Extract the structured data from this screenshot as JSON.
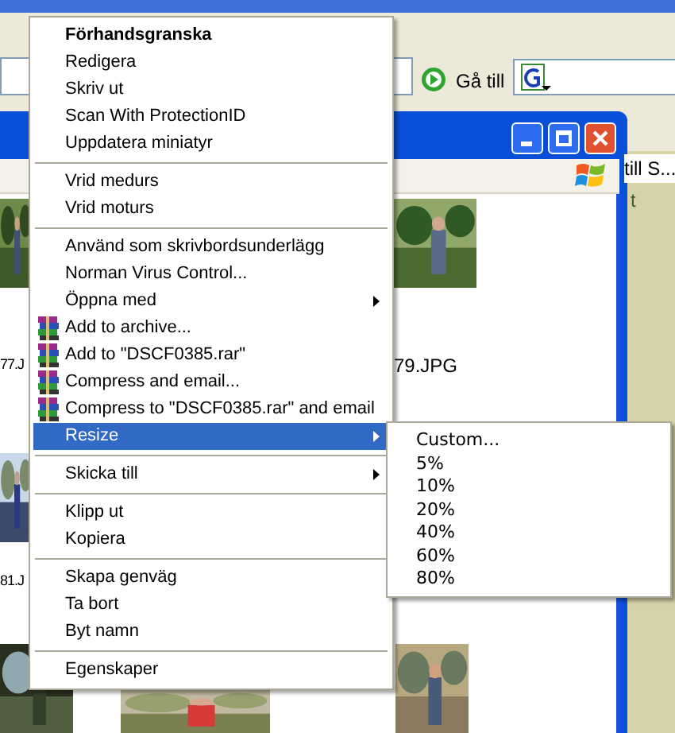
{
  "browser": {
    "go_label": "Gå till"
  },
  "window": {
    "toolbar_text": "till S...",
    "side_text": "t"
  },
  "thumbnails": [
    {
      "caption": "77.J"
    },
    {
      "caption": "79.JPG"
    },
    {
      "caption": "81.J"
    }
  ],
  "context_menu": {
    "items": [
      {
        "kind": "item",
        "label": "Förhandsgranska",
        "bold": true,
        "submenu": false,
        "selected": false
      },
      {
        "kind": "item",
        "label": "Redigera",
        "bold": false,
        "submenu": false,
        "selected": false
      },
      {
        "kind": "item",
        "label": "Skriv ut",
        "bold": false,
        "submenu": false,
        "selected": false
      },
      {
        "kind": "item",
        "label": "Scan With ProtectionID",
        "bold": false,
        "submenu": false,
        "selected": false
      },
      {
        "kind": "item",
        "label": "Uppdatera miniatyr",
        "bold": false,
        "submenu": false,
        "selected": false
      },
      {
        "kind": "separator"
      },
      {
        "kind": "item",
        "label": "Vrid medurs",
        "bold": false,
        "submenu": false,
        "selected": false
      },
      {
        "kind": "item",
        "label": "Vrid moturs",
        "bold": false,
        "submenu": false,
        "selected": false
      },
      {
        "kind": "separator"
      },
      {
        "kind": "item",
        "label": "Använd som skrivbordsunderlägg",
        "bold": false,
        "submenu": false,
        "selected": false
      },
      {
        "kind": "item",
        "label": "Norman Virus Control...",
        "bold": false,
        "submenu": false,
        "selected": false
      },
      {
        "kind": "item",
        "label": "Öppna med",
        "bold": false,
        "submenu": true,
        "selected": false
      },
      {
        "kind": "archive_item",
        "label": "Add to archive...",
        "bold": false,
        "submenu": false,
        "selected": false
      },
      {
        "kind": "archive_item",
        "label": "Add to \"DSCF0385.rar\"",
        "bold": false,
        "submenu": false,
        "selected": false
      },
      {
        "kind": "archive_item",
        "label": "Compress and email...",
        "bold": false,
        "submenu": false,
        "selected": false
      },
      {
        "kind": "archive_item",
        "label": "Compress to \"DSCF0385.rar\" and email",
        "bold": false,
        "submenu": false,
        "selected": false
      },
      {
        "kind": "item",
        "label": "Resize",
        "bold": false,
        "submenu": true,
        "selected": true
      },
      {
        "kind": "separator"
      },
      {
        "kind": "item",
        "label": "Skicka till",
        "bold": false,
        "submenu": true,
        "selected": false
      },
      {
        "kind": "separator"
      },
      {
        "kind": "item",
        "label": "Klipp ut",
        "bold": false,
        "submenu": false,
        "selected": false
      },
      {
        "kind": "item",
        "label": "Kopiera",
        "bold": false,
        "submenu": false,
        "selected": false
      },
      {
        "kind": "separator"
      },
      {
        "kind": "item",
        "label": "Skapa genväg",
        "bold": false,
        "submenu": false,
        "selected": false
      },
      {
        "kind": "item",
        "label": "Ta bort",
        "bold": false,
        "submenu": false,
        "selected": false
      },
      {
        "kind": "item",
        "label": "Byt namn",
        "bold": false,
        "submenu": false,
        "selected": false
      },
      {
        "kind": "separator"
      },
      {
        "kind": "item",
        "label": "Egenskaper",
        "bold": false,
        "submenu": false,
        "selected": false
      }
    ]
  },
  "resize_submenu": {
    "items": [
      {
        "label": "Custom..."
      },
      {
        "label": "5%"
      },
      {
        "label": "10%"
      },
      {
        "label": "20%"
      },
      {
        "label": "40%"
      },
      {
        "label": "60%"
      },
      {
        "label": "80%"
      }
    ]
  }
}
